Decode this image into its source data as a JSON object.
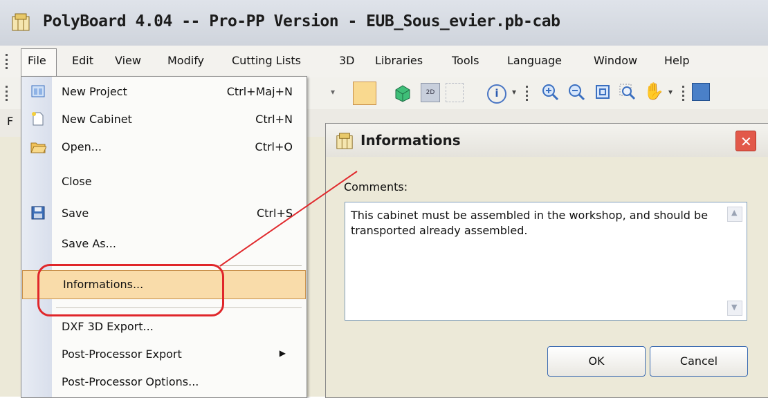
{
  "window": {
    "title": "PolyBoard 4.04 -- Pro-PP Version - EUB_Sous_evier.pb-cab"
  },
  "menubar": {
    "items": [
      "File",
      "Edit",
      "View",
      "Modify",
      "Cutting Lists",
      "3D",
      "Libraries",
      "Tools",
      "Language",
      "Window",
      "Help"
    ]
  },
  "tabstrip": {
    "partial_label": "F"
  },
  "file_menu": {
    "items": [
      {
        "label": "New Project",
        "shortcut": "Ctrl+Maj+N",
        "icon": "new-project-icon"
      },
      {
        "label": "New Cabinet",
        "shortcut": "Ctrl+N",
        "icon": "new-cabinet-icon"
      },
      {
        "label": "Open...",
        "shortcut": "Ctrl+O",
        "icon": "open-folder-icon"
      },
      {
        "label": "Close",
        "shortcut": ""
      },
      {
        "label": "Save",
        "shortcut": "Ctrl+S",
        "icon": "floppy-disk-icon"
      },
      {
        "label": "Save As...",
        "shortcut": ""
      },
      {
        "label": "Informations...",
        "shortcut": ""
      },
      {
        "label": "DXF 3D Export...",
        "shortcut": ""
      },
      {
        "label": "Post-Processor Export",
        "shortcut": "",
        "submenu": true
      },
      {
        "label": "Post-Processor Options...",
        "shortcut": ""
      }
    ]
  },
  "dialog": {
    "title": "Informations",
    "comments_label": "Comments:",
    "comments_text": "This cabinet must be assembled in the workshop, and should be transported already assembled.",
    "ok_label": "OK",
    "cancel_label": "Cancel"
  },
  "colors": {
    "highlight": "#f9dcaa",
    "annotation": "#e0262a",
    "close_button": "#e2594a"
  }
}
